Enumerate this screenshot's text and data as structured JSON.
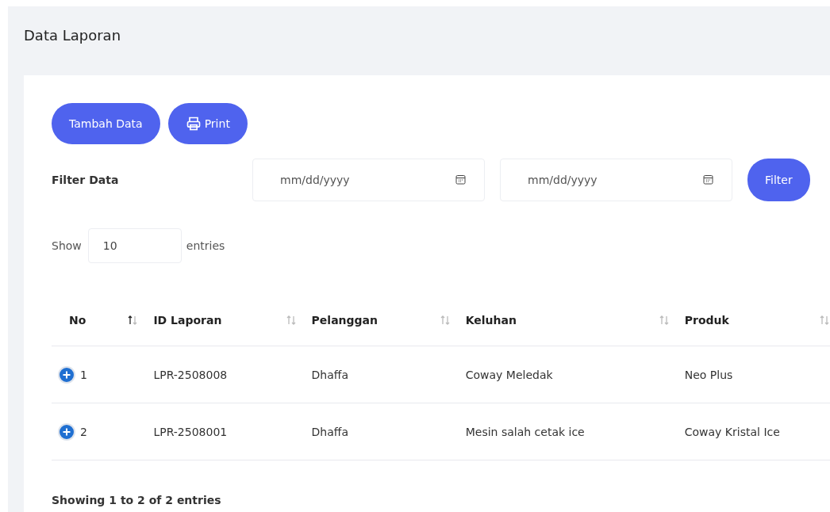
{
  "page_title": "Data Laporan",
  "actions": [
    {
      "kind": "text",
      "label": "Tambah Data"
    },
    {
      "kind": "print",
      "label": "Print"
    }
  ],
  "filter": {
    "label": "Filter Data",
    "date_from": {
      "placeholder": "mm/dd/yyyy"
    },
    "date_to": {
      "placeholder": "mm/dd/yyyy"
    },
    "button": "Filter"
  },
  "length": {
    "prefix": "Show",
    "value": "10",
    "suffix": "entries"
  },
  "table": {
    "columns": [
      {
        "label": "No",
        "sorted_ascending": true
      },
      {
        "label": "ID Laporan",
        "sorted_ascending": false
      },
      {
        "label": "Pelanggan",
        "sorted_ascending": false
      },
      {
        "label": "Keluhan",
        "sorted_ascending": false
      },
      {
        "label": "Produk",
        "sorted_ascending": false
      }
    ],
    "rows": [
      {
        "cells": [
          "1",
          "LPR-2508008",
          "Dhaffa",
          "Coway Meledak",
          "Neo Plus"
        ]
      },
      {
        "cells": [
          "2",
          "LPR-2508001",
          "Dhaffa",
          "Mesin salah cetak ice",
          "Coway Kristal Ice"
        ]
      }
    ]
  },
  "info": "Showing 1 to 2 of 2 entries"
}
